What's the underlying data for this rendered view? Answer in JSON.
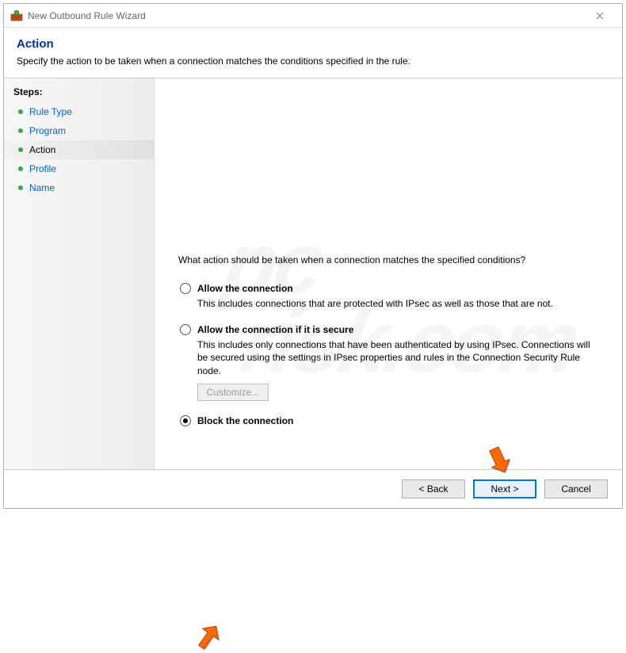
{
  "window": {
    "title": "New Outbound Rule Wizard"
  },
  "header": {
    "title": "Action",
    "subtitle": "Specify the action to be taken when a connection matches the conditions specified in the rule."
  },
  "sidebar": {
    "title": "Steps:",
    "items": [
      {
        "label": "Rule Type",
        "current": false
      },
      {
        "label": "Program",
        "current": false
      },
      {
        "label": "Action",
        "current": true
      },
      {
        "label": "Profile",
        "current": false
      },
      {
        "label": "Name",
        "current": false
      }
    ]
  },
  "main": {
    "question": "What action should be taken when a connection matches the specified conditions?",
    "options": [
      {
        "id": "allow",
        "label": "Allow the connection",
        "description": "This includes connections that are protected with IPsec as well as those that are not.",
        "selected": false
      },
      {
        "id": "allow-secure",
        "label": "Allow the connection if it is secure",
        "description": "This includes only connections that have been authenticated by using IPsec.  Connections will be secured using the settings in IPsec properties and rules in the Connection Security Rule node.",
        "selected": false,
        "customize_label": "Customize..."
      },
      {
        "id": "block",
        "label": "Block the connection",
        "description": "",
        "selected": true
      }
    ]
  },
  "footer": {
    "back": "< Back",
    "next": "Next >",
    "cancel": "Cancel"
  },
  "watermark": {
    "line1": "pc",
    "line2": "risk.com"
  }
}
